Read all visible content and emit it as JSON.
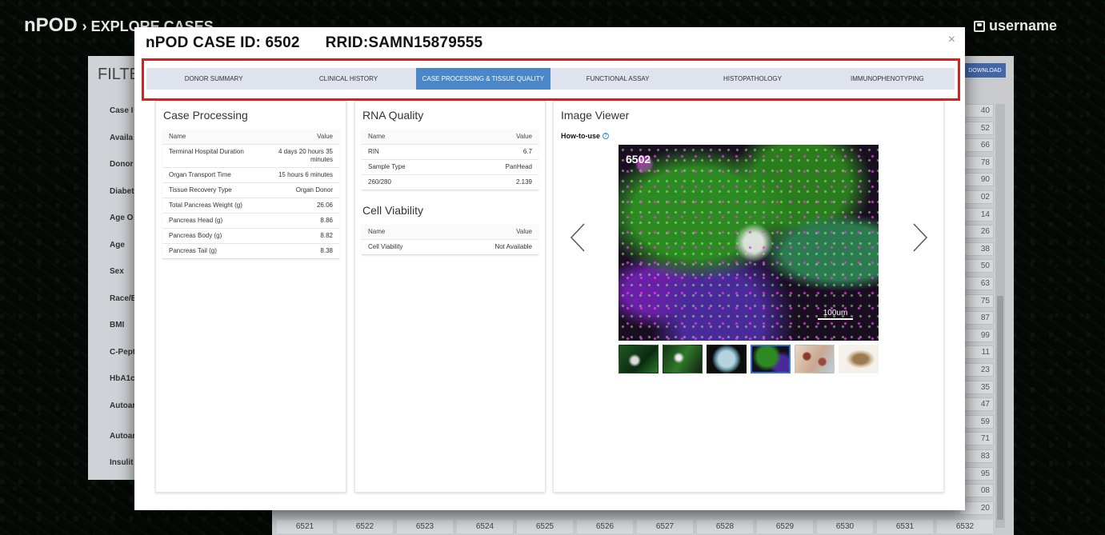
{
  "background": {
    "brand": "nPOD",
    "breadcrumb": "› EXPLORE CASES",
    "user": "username",
    "filter_title": "FILTE",
    "filter_items": [
      "Case I",
      "Availa",
      "Donor",
      "Diabet",
      "Age O",
      "Age",
      "Sex",
      "Race/E",
      "BMI",
      "C-Pept",
      "HbA1c",
      "Autoar",
      "Autoar",
      "Insulit"
    ],
    "download_label": "DOWNLOAD",
    "id_column": [
      "40",
      "52",
      "66",
      "78",
      "90",
      "02",
      "14",
      "26",
      "38",
      "50",
      "63",
      "75",
      "87",
      "99",
      "11",
      "23",
      "35",
      "47",
      "59",
      "71",
      "83",
      "95",
      "08",
      "20"
    ],
    "bottom_row": [
      "6521",
      "6522",
      "6523",
      "6524",
      "6525",
      "6526",
      "6527",
      "6528",
      "6529",
      "6530",
      "6531",
      "6532"
    ]
  },
  "modal": {
    "case_id": "nPOD CASE ID: 6502",
    "rrid": "RRID:SAMN15879555",
    "close_label": "×",
    "tabs": [
      {
        "label": "DONOR SUMMARY",
        "active": false
      },
      {
        "label": "CLINICAL HISTORY",
        "active": false
      },
      {
        "label": "CASE PROCESSING & TISSUE QUALITY",
        "active": true
      },
      {
        "label": "FUNCTIONAL ASSAY",
        "active": false
      },
      {
        "label": "HISTOPATHOLOGY",
        "active": false
      },
      {
        "label": "IMMUNOPHENOTYPING",
        "active": false
      }
    ],
    "case_processing": {
      "title": "Case Processing",
      "col_name": "Name",
      "col_value": "Value",
      "rows": [
        {
          "name": "Terminal Hospital Duration",
          "value": "4 days 20 hours 35 minutes"
        },
        {
          "name": "Organ Transport Time",
          "value": "15 hours 6 minutes"
        },
        {
          "name": "Tissue Recovery Type",
          "value": "Organ Donor"
        },
        {
          "name": "Total Pancreas Weight (g)",
          "value": "26.06"
        },
        {
          "name": "Pancreas Head (g)",
          "value": "8.86"
        },
        {
          "name": "Pancreas Body (g)",
          "value": "8.82"
        },
        {
          "name": "Pancreas Tail (g)",
          "value": "8.38"
        }
      ]
    },
    "rna_quality": {
      "title": "RNA Quality",
      "col_name": "Name",
      "col_value": "Value",
      "rows": [
        {
          "name": "RIN",
          "value": "6.7"
        },
        {
          "name": "Sample Type",
          "value": "PanHead"
        },
        {
          "name": "260/280",
          "value": "2.139"
        }
      ]
    },
    "cell_viability": {
      "title": "Cell Viability",
      "col_name": "Name",
      "col_value": "Value",
      "rows": [
        {
          "name": "Cell Viability",
          "value": "Not Available"
        }
      ]
    },
    "image_viewer": {
      "title": "Image Viewer",
      "how_to_use": "How-to-use",
      "image_label": "6502",
      "scale_label": "100um",
      "selected_thumbnail": 4,
      "thumbnail_count": 6
    }
  }
}
